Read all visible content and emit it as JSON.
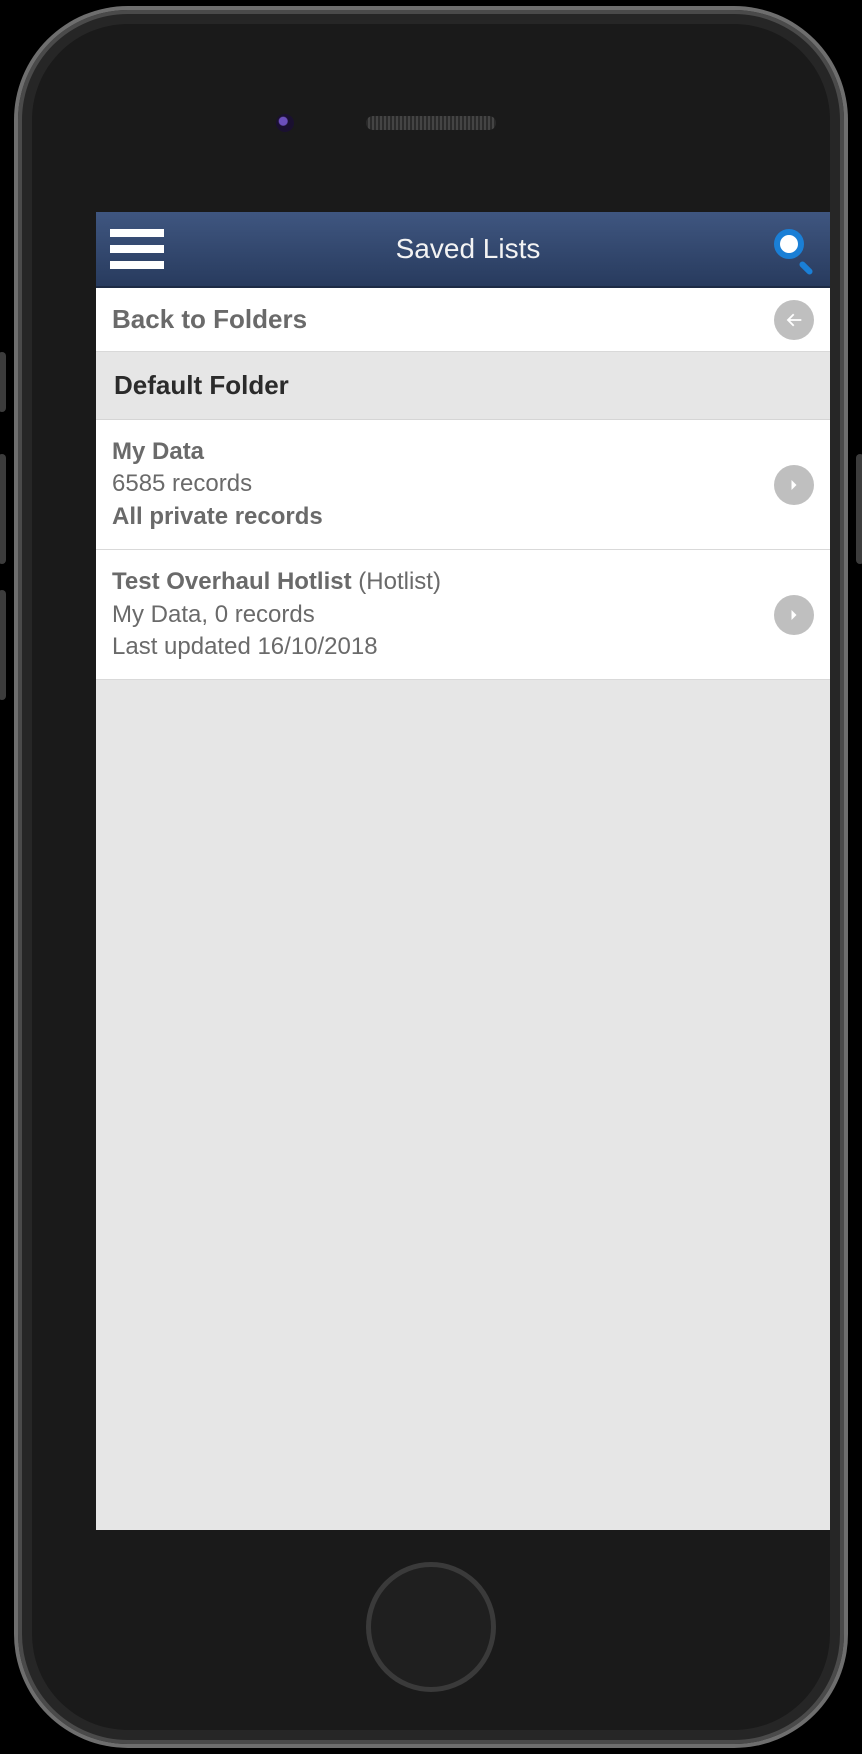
{
  "header": {
    "title": "Saved Lists"
  },
  "back": {
    "label": "Back to Folders"
  },
  "section": {
    "title": "Default Folder"
  },
  "items": [
    {
      "title": "My Data",
      "tag": "",
      "line2": "6585 records",
      "line3": "All private records",
      "line3_bold": true
    },
    {
      "title": "Test Overhaul Hotlist",
      "tag": "(Hotlist)",
      "line2": "My Data, 0 records",
      "line3": "Last updated 16/10/2018",
      "line3_bold": false
    }
  ]
}
